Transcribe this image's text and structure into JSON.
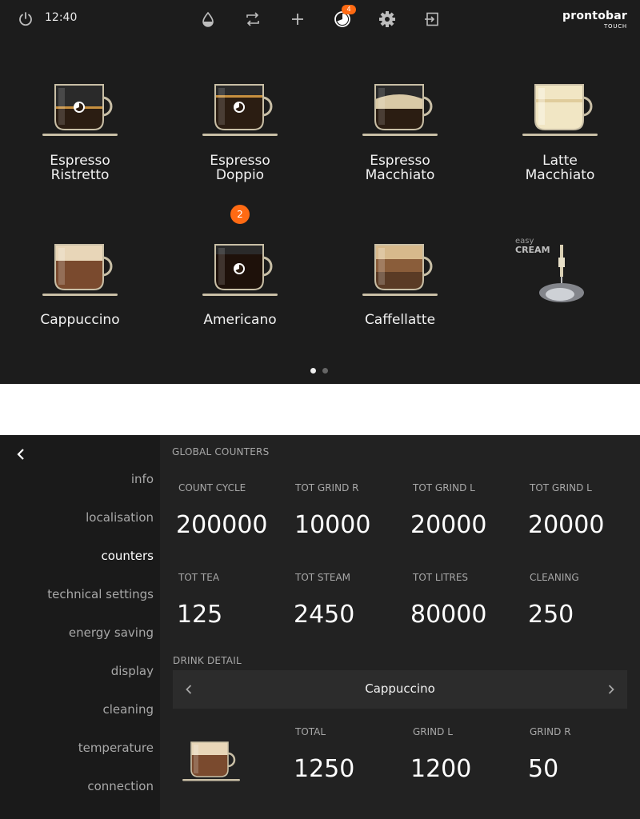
{
  "status_bar": {
    "time": "12:40",
    "notification_count": "4",
    "logo_line1": "prontobar",
    "logo_line2": "TOUCH"
  },
  "drinks": [
    {
      "line1": "Espresso",
      "line2": "Ristretto"
    },
    {
      "line1": "Espresso",
      "line2": "Doppio"
    },
    {
      "line1": "Espresso",
      "line2": "Macchiato"
    },
    {
      "line1": "Latte",
      "line2": "Macchiato"
    },
    {
      "line1": "Cappuccino"
    },
    {
      "line1": "Americano"
    },
    {
      "line1": "Caffellatte"
    }
  ],
  "americano_queue_count": "2",
  "easy_cream": {
    "line1": "easy",
    "line2": "CREAM"
  },
  "pager": {
    "pages": 2,
    "current": 1
  },
  "settings": {
    "menu": [
      "info",
      "localisation",
      "counters",
      "technical settings",
      "energy saving",
      "display",
      "cleaning",
      "temperature",
      "connection"
    ],
    "active": "counters",
    "global_title": "GLOBAL COUNTERS",
    "counters": [
      {
        "label": "COUNT CYCLE",
        "value": "200000"
      },
      {
        "label": "TOT GRIND R",
        "value": "10000"
      },
      {
        "label": "TOT GRIND L",
        "value": "20000"
      },
      {
        "label": "TOT GRIND L",
        "value": "20000"
      },
      {
        "label": "TOT TEA",
        "value": "125"
      },
      {
        "label": "TOT STEAM",
        "value": "2450"
      },
      {
        "label": "TOT LITRES",
        "value": "80000"
      },
      {
        "label": "CLEANING",
        "value": "250"
      }
    ],
    "drink_detail_title": "DRINK DETAIL",
    "selected_drink": "Cappuccino",
    "detail": [
      {
        "label": "TOTAL",
        "value": "1250"
      },
      {
        "label": "GRIND L",
        "value": "1200"
      },
      {
        "label": "GRIND R",
        "value": "50"
      }
    ]
  },
  "colors": {
    "accent": "#ff6a13",
    "background": "#1c1c1c",
    "text": "#ffffff",
    "muted": "#a8a8a8"
  }
}
